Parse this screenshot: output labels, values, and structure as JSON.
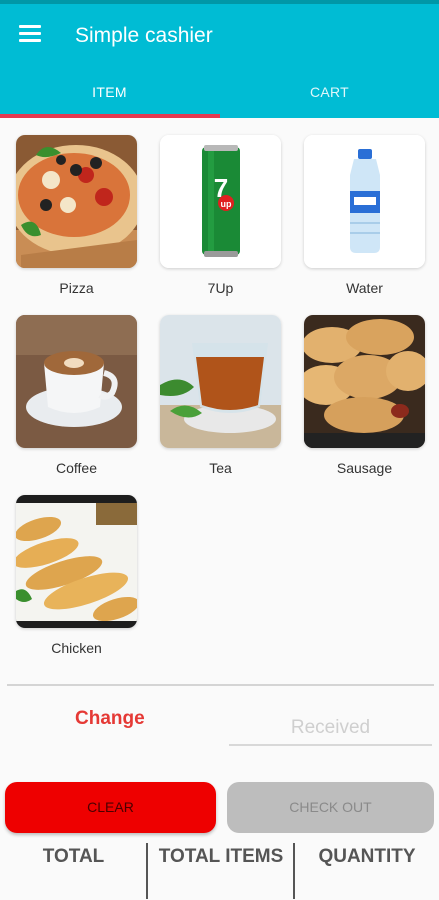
{
  "app": {
    "title": "Simple cashier",
    "menu_icon": "hamburger-menu-icon",
    "accent": "#00bcd4",
    "tab_indicator": "#e53950"
  },
  "tabs": [
    {
      "label": "ITEM",
      "selected": true
    },
    {
      "label": "CART",
      "selected": false
    }
  ],
  "items": [
    {
      "name": "Pizza",
      "image": "pizza-image"
    },
    {
      "name": "7Up",
      "image": "7up-can-image"
    },
    {
      "name": "Water",
      "image": "water-bottle-image"
    },
    {
      "name": "Coffee",
      "image": "coffee-cup-image"
    },
    {
      "name": "Tea",
      "image": "tea-cup-image"
    },
    {
      "name": "Sausage",
      "image": "sausage-rolls-image"
    },
    {
      "name": "Chicken",
      "image": "chicken-bread-image"
    }
  ],
  "payment": {
    "change_label": "Change",
    "received_placeholder": "Received",
    "received_value": ""
  },
  "actions": {
    "clear_label": "CLEAR",
    "clear_color": "#ee0000",
    "checkout_label": "CHECK OUT",
    "checkout_enabled": false
  },
  "summary": {
    "total_label": "TOTAL",
    "total_items_label": "TOTAL ITEMS",
    "quantity_label": "QUANTITY"
  }
}
